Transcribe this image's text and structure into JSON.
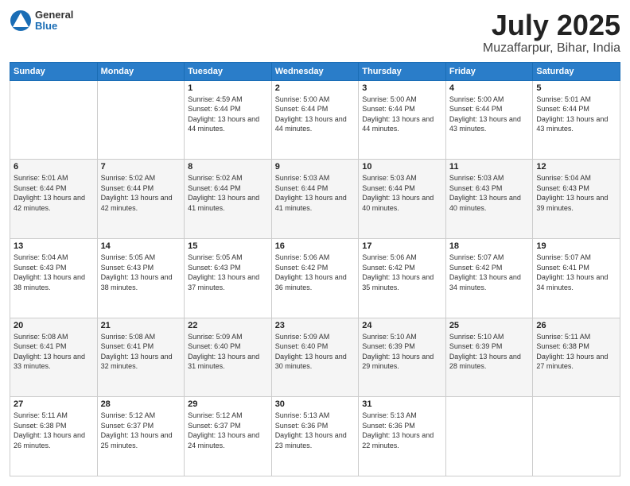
{
  "header": {
    "logo_general": "General",
    "logo_blue": "Blue",
    "title": "July 2025",
    "subtitle": "Muzaffarpur, Bihar, India"
  },
  "weekdays": [
    "Sunday",
    "Monday",
    "Tuesday",
    "Wednesday",
    "Thursday",
    "Friday",
    "Saturday"
  ],
  "weeks": [
    [
      {
        "day": "",
        "info": ""
      },
      {
        "day": "",
        "info": ""
      },
      {
        "day": "1",
        "info": "Sunrise: 4:59 AM\nSunset: 6:44 PM\nDaylight: 13 hours and 44 minutes."
      },
      {
        "day": "2",
        "info": "Sunrise: 5:00 AM\nSunset: 6:44 PM\nDaylight: 13 hours and 44 minutes."
      },
      {
        "day": "3",
        "info": "Sunrise: 5:00 AM\nSunset: 6:44 PM\nDaylight: 13 hours and 44 minutes."
      },
      {
        "day": "4",
        "info": "Sunrise: 5:00 AM\nSunset: 6:44 PM\nDaylight: 13 hours and 43 minutes."
      },
      {
        "day": "5",
        "info": "Sunrise: 5:01 AM\nSunset: 6:44 PM\nDaylight: 13 hours and 43 minutes."
      }
    ],
    [
      {
        "day": "6",
        "info": "Sunrise: 5:01 AM\nSunset: 6:44 PM\nDaylight: 13 hours and 42 minutes."
      },
      {
        "day": "7",
        "info": "Sunrise: 5:02 AM\nSunset: 6:44 PM\nDaylight: 13 hours and 42 minutes."
      },
      {
        "day": "8",
        "info": "Sunrise: 5:02 AM\nSunset: 6:44 PM\nDaylight: 13 hours and 41 minutes."
      },
      {
        "day": "9",
        "info": "Sunrise: 5:03 AM\nSunset: 6:44 PM\nDaylight: 13 hours and 41 minutes."
      },
      {
        "day": "10",
        "info": "Sunrise: 5:03 AM\nSunset: 6:44 PM\nDaylight: 13 hours and 40 minutes."
      },
      {
        "day": "11",
        "info": "Sunrise: 5:03 AM\nSunset: 6:43 PM\nDaylight: 13 hours and 40 minutes."
      },
      {
        "day": "12",
        "info": "Sunrise: 5:04 AM\nSunset: 6:43 PM\nDaylight: 13 hours and 39 minutes."
      }
    ],
    [
      {
        "day": "13",
        "info": "Sunrise: 5:04 AM\nSunset: 6:43 PM\nDaylight: 13 hours and 38 minutes."
      },
      {
        "day": "14",
        "info": "Sunrise: 5:05 AM\nSunset: 6:43 PM\nDaylight: 13 hours and 38 minutes."
      },
      {
        "day": "15",
        "info": "Sunrise: 5:05 AM\nSunset: 6:43 PM\nDaylight: 13 hours and 37 minutes."
      },
      {
        "day": "16",
        "info": "Sunrise: 5:06 AM\nSunset: 6:42 PM\nDaylight: 13 hours and 36 minutes."
      },
      {
        "day": "17",
        "info": "Sunrise: 5:06 AM\nSunset: 6:42 PM\nDaylight: 13 hours and 35 minutes."
      },
      {
        "day": "18",
        "info": "Sunrise: 5:07 AM\nSunset: 6:42 PM\nDaylight: 13 hours and 34 minutes."
      },
      {
        "day": "19",
        "info": "Sunrise: 5:07 AM\nSunset: 6:41 PM\nDaylight: 13 hours and 34 minutes."
      }
    ],
    [
      {
        "day": "20",
        "info": "Sunrise: 5:08 AM\nSunset: 6:41 PM\nDaylight: 13 hours and 33 minutes."
      },
      {
        "day": "21",
        "info": "Sunrise: 5:08 AM\nSunset: 6:41 PM\nDaylight: 13 hours and 32 minutes."
      },
      {
        "day": "22",
        "info": "Sunrise: 5:09 AM\nSunset: 6:40 PM\nDaylight: 13 hours and 31 minutes."
      },
      {
        "day": "23",
        "info": "Sunrise: 5:09 AM\nSunset: 6:40 PM\nDaylight: 13 hours and 30 minutes."
      },
      {
        "day": "24",
        "info": "Sunrise: 5:10 AM\nSunset: 6:39 PM\nDaylight: 13 hours and 29 minutes."
      },
      {
        "day": "25",
        "info": "Sunrise: 5:10 AM\nSunset: 6:39 PM\nDaylight: 13 hours and 28 minutes."
      },
      {
        "day": "26",
        "info": "Sunrise: 5:11 AM\nSunset: 6:38 PM\nDaylight: 13 hours and 27 minutes."
      }
    ],
    [
      {
        "day": "27",
        "info": "Sunrise: 5:11 AM\nSunset: 6:38 PM\nDaylight: 13 hours and 26 minutes."
      },
      {
        "day": "28",
        "info": "Sunrise: 5:12 AM\nSunset: 6:37 PM\nDaylight: 13 hours and 25 minutes."
      },
      {
        "day": "29",
        "info": "Sunrise: 5:12 AM\nSunset: 6:37 PM\nDaylight: 13 hours and 24 minutes."
      },
      {
        "day": "30",
        "info": "Sunrise: 5:13 AM\nSunset: 6:36 PM\nDaylight: 13 hours and 23 minutes."
      },
      {
        "day": "31",
        "info": "Sunrise: 5:13 AM\nSunset: 6:36 PM\nDaylight: 13 hours and 22 minutes."
      },
      {
        "day": "",
        "info": ""
      },
      {
        "day": "",
        "info": ""
      }
    ]
  ]
}
